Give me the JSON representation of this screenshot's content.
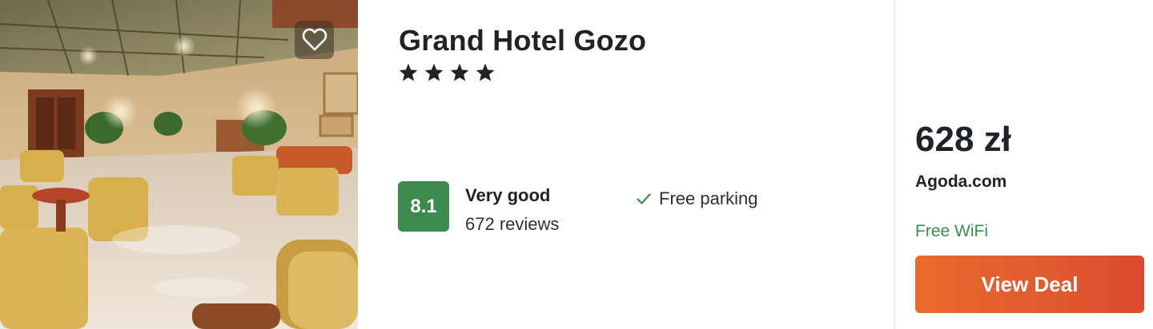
{
  "hotel": {
    "name": "Grand Hotel Gozo",
    "star_rating": 4,
    "photo_icon": "hotel-lobby-photo",
    "favorite_icon": "heart-icon"
  },
  "rating": {
    "score": "8.1",
    "label": "Very good",
    "reviews": "672 reviews",
    "badge_color": "#3d8a4f"
  },
  "amenities": [
    {
      "icon": "check-icon",
      "label": "Free parking"
    }
  ],
  "offer": {
    "price": "628 zł",
    "provider": "Agoda.com",
    "perk": "Free WiFi",
    "cta_label": "View Deal",
    "cta_color": "#e05a30",
    "perk_color": "#3d8a4f"
  }
}
